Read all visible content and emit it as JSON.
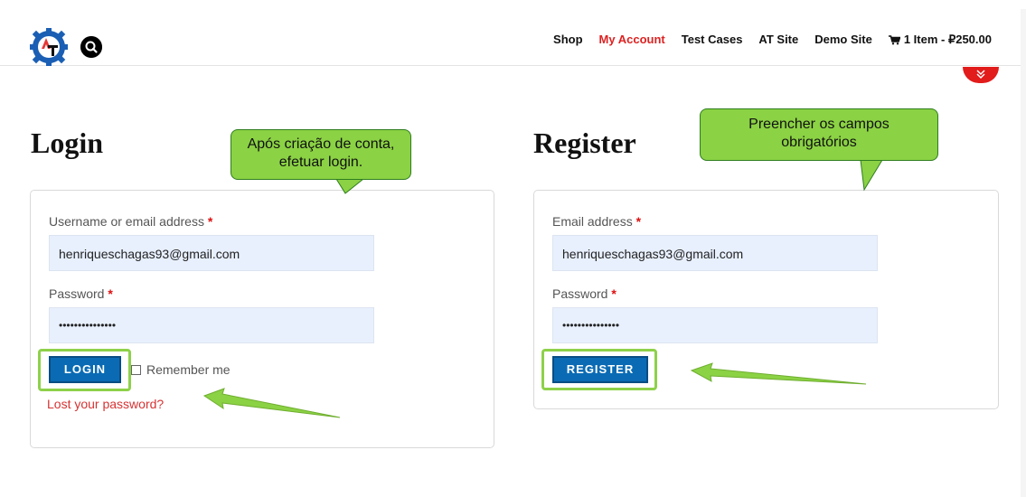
{
  "header": {
    "nav": {
      "shop": "Shop",
      "my_account": "My Account",
      "test_cases": "Test Cases",
      "at_site": "AT Site",
      "demo_site": "Demo Site",
      "cart": "1 Item - ₽250.00"
    }
  },
  "login": {
    "title": "Login",
    "username_label": "Username or email address",
    "username_value": "henriqueschagas93@gmail.com",
    "password_label": "Password",
    "password_value": "•••••••••••••••",
    "login_button": "LOGIN",
    "remember_label": "Remember me",
    "lost_password": "Lost your password?"
  },
  "register": {
    "title": "Register",
    "email_label": "Email address",
    "email_value": "henriqueschagas93@gmail.com",
    "password_label": "Password",
    "password_value": "•••••••••••••••",
    "register_button": "REGISTER"
  },
  "required_mark": "*",
  "annotations": {
    "login_note": "Após criação de conta, efetuar login.",
    "register_note": "Preencher os campos obrigatórios"
  },
  "colors": {
    "accent": "#dd2222",
    "button": "#0a6bb4",
    "callout": "#8bd244",
    "input_bg": "#e8f0fe"
  }
}
